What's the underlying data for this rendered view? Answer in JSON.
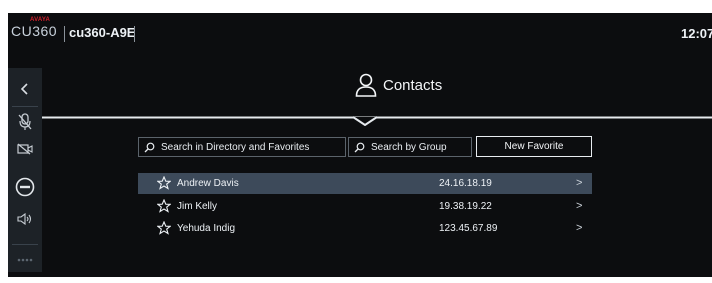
{
  "topbar": {
    "maker": "AVAYA",
    "model": "CU360",
    "device_name": "cu360-A9E",
    "time": "12:07"
  },
  "rail": {
    "icons": [
      "chevron-left-icon",
      "mic-mute-icon",
      "camera-off-icon",
      "minus-circle-icon",
      "volume-icon",
      "more-icon"
    ]
  },
  "contacts": {
    "title": "Contacts",
    "search_directory": "Search in Directory and Favorites",
    "search_group": "Search by Group",
    "new_favorite": "New Favorite",
    "entries": [
      {
        "name": "Andrew Davis",
        "address": "24.16.18.19",
        "selected": true
      },
      {
        "name": "Jim Kelly",
        "address": "19.38.19.22",
        "selected": false
      },
      {
        "name": "Yehuda Indig",
        "address": "123.45.67.89",
        "selected": false
      }
    ]
  },
  "colors": {
    "background": "#0c0d0f",
    "rail": "#1d2227",
    "selected_row": "#3d4a5a",
    "brand_red": "#d51f2b"
  }
}
